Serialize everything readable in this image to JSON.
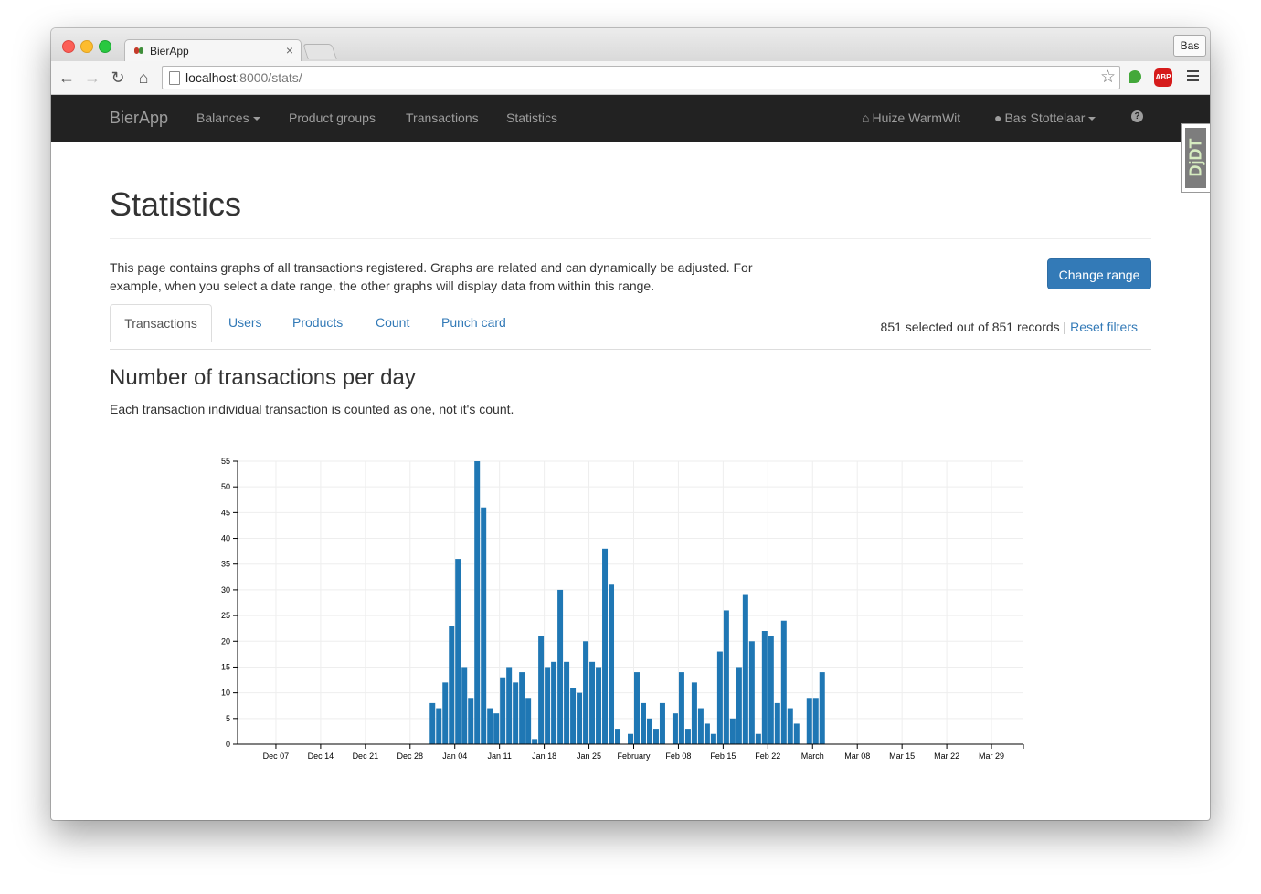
{
  "browser": {
    "tab_title": "BierApp",
    "tab_close": "×",
    "profile_name": "Bas",
    "url_host": "localhost",
    "url_rest": ":8000/stats/",
    "abp_label": "ABP"
  },
  "navbar": {
    "brand": "BierApp",
    "balances": "Balances",
    "product_groups": "Product groups",
    "transactions": "Transactions",
    "statistics": "Statistics",
    "house": "Huize WarmWit",
    "user": "Bas Stottelaar",
    "help": "?"
  },
  "djdt_label": "DjDT",
  "page": {
    "title": "Statistics",
    "intro": "This page contains graphs of all transactions registered. Graphs are related and can dynamically be adjusted. For example, when you select a date range, the other graphs will display data from within this range.",
    "change_range": "Change range",
    "tabs": [
      "Transactions",
      "Users",
      "Products",
      "Count",
      "Punch card"
    ],
    "records_text": "851 selected out of 851 records |",
    "reset_filters": "Reset filters",
    "section_title": "Number of transactions per day",
    "section_subtitle": "Each transaction individual transaction is counted as one, not it's count."
  },
  "colors": {
    "bar": "#1f77b4",
    "navbar": "#222222",
    "primary": "#337ab7"
  },
  "chart_data": {
    "type": "bar",
    "title": "Number of transactions per day",
    "x_start": "2015-12-01",
    "x_end": "2016-04-02",
    "ylim": [
      0,
      55
    ],
    "yticks": [
      0,
      5,
      10,
      15,
      20,
      25,
      30,
      35,
      40,
      45,
      50,
      55
    ],
    "xticks": [
      "Dec 07",
      "Dec 14",
      "Dec 21",
      "Dec 28",
      "Jan 04",
      "Jan 11",
      "Jan 18",
      "Jan 25",
      "February",
      "Feb 08",
      "Feb 15",
      "Feb 22",
      "March",
      "Mar 08",
      "Mar 15",
      "Mar 22",
      "Mar 29"
    ],
    "grid": true,
    "series": [
      {
        "start_date": "2015-12-31",
        "values": [
          8,
          7,
          12,
          23,
          36,
          15,
          9,
          55,
          46,
          7,
          6,
          13,
          15,
          12,
          14,
          9,
          1,
          21,
          15,
          16,
          30,
          16,
          11,
          10,
          20,
          16,
          15,
          38,
          31,
          3,
          0,
          2,
          14,
          8,
          5,
          3,
          8,
          0,
          6,
          14,
          3,
          12,
          7,
          4,
          2,
          18,
          26,
          5,
          15,
          29,
          20,
          2,
          22,
          21,
          8,
          24,
          7,
          4,
          0,
          9,
          9,
          14
        ]
      }
    ]
  }
}
